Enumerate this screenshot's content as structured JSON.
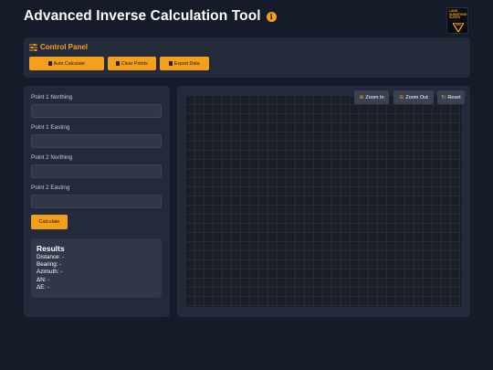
{
  "header": {
    "title": "Advanced Inverse Calculation Tool",
    "info_icon": "i",
    "logo_text": [
      "LAND",
      "SURVEYING",
      "SUITES"
    ]
  },
  "control_panel": {
    "title": "Control Panel",
    "buttons": {
      "auto_calculate": "Auto Calculate",
      "clear_points": "Clear Points",
      "export_data": "Export Data"
    }
  },
  "form": {
    "p1_northing_label": "Point 1 Northing",
    "p1_easting_label": "Point 1 Easting",
    "p2_northing_label": "Point 2 Northing",
    "p2_easting_label": "Point 2 Easting",
    "p1_northing_value": "",
    "p1_easting_value": "",
    "p2_northing_value": "",
    "p2_easting_value": "",
    "calculate_label": "Calculate"
  },
  "results": {
    "title": "Results",
    "distance": "Distance: -",
    "bearing": "Bearing: -",
    "azimuth": "Azimuth: -",
    "delta_n": "ΔN: -",
    "delta_e": "ΔE: -"
  },
  "canvas_controls": {
    "zoom_in": "Zoom In",
    "zoom_out": "Zoom Out",
    "reset": "Reset"
  },
  "colors": {
    "accent": "#f5a01c",
    "background": "#161b2a",
    "panel": "#232a3a"
  },
  "icons": {
    "info": "info-icon",
    "control_panel": "sliders-icon",
    "auto_calculate": "calculator-icon",
    "clear_points": "trash-icon",
    "export_data": "export-icon",
    "zoom_in": "zoom-in-icon",
    "zoom_out": "zoom-out-icon",
    "reset": "reset-icon"
  }
}
